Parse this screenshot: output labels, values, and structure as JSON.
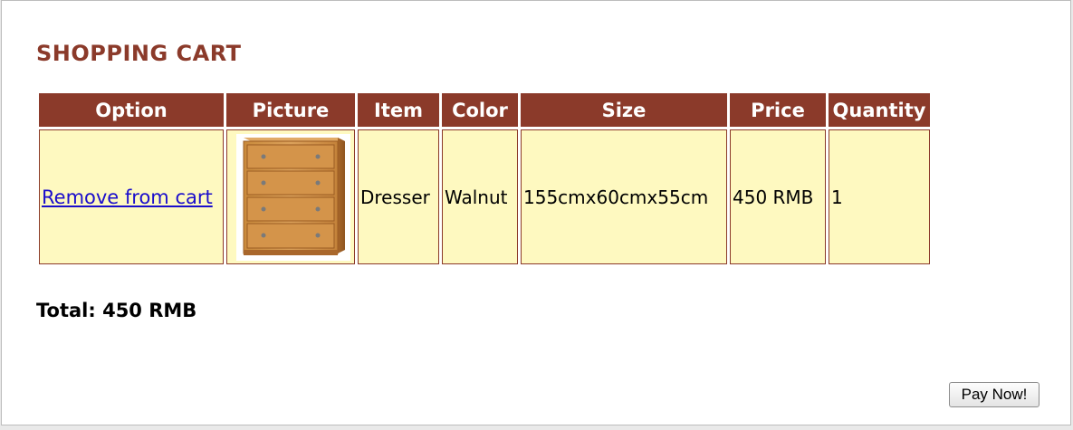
{
  "page": {
    "title": "SHOPPING CART"
  },
  "table": {
    "headers": {
      "option": "Option",
      "picture": "Picture",
      "item": "Item",
      "color": "Color",
      "size": "Size",
      "price": "Price",
      "quantity": "Quantity"
    },
    "rows": [
      {
        "option_link": "Remove from cart",
        "picture_icon": "dresser-image",
        "item": "Dresser",
        "color": "Walnut",
        "size": "155cmx60cmx55cm",
        "price": "450 RMB",
        "quantity": "1"
      }
    ]
  },
  "total": {
    "text": "Total: 450 RMB"
  },
  "actions": {
    "pay_label": "Pay Now!"
  },
  "colors": {
    "accent": "#8b3a2a",
    "cell_background": "#fef9c0",
    "link": "#1a0dcc"
  }
}
